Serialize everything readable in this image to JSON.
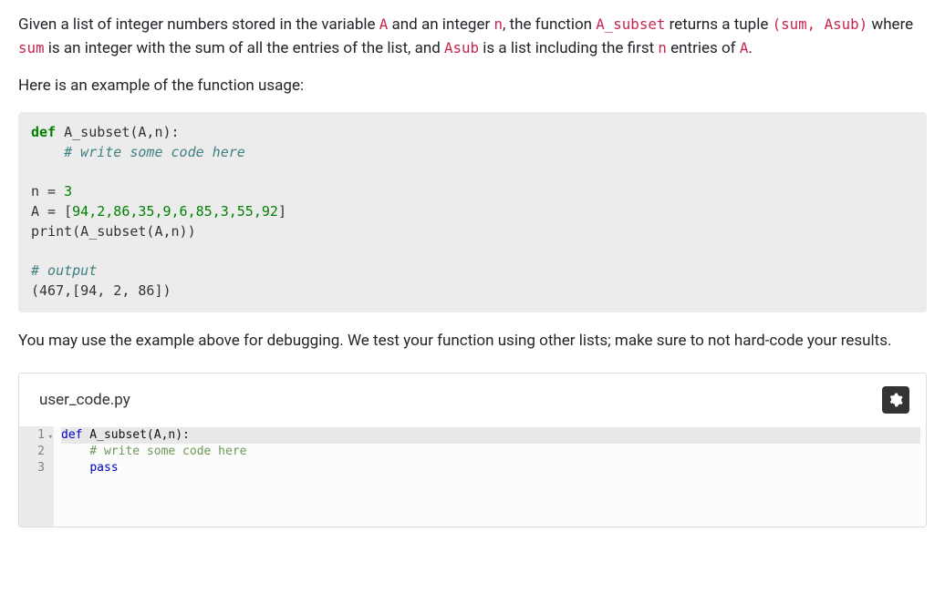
{
  "intro": {
    "t1": "Given a list of integer numbers stored in the variable ",
    "c1": "A",
    "t2": " and an integer ",
    "c2": "n",
    "t3": ", the function ",
    "c3": "A_subset",
    "t4": " returns a tuple ",
    "c4": "(sum, Asub)",
    "t5": " where ",
    "c5": "sum",
    "t6": " is an integer with the sum of all the entries of the list, and ",
    "c6": "Asub",
    "t7": " is a list including the first ",
    "c7": "n",
    "t8": " entries of ",
    "c8": "A",
    "t9": "."
  },
  "example_lead": "Here is an example of the function usage:",
  "code": {
    "kw_def": "def",
    "fn": "A_subset",
    "params": "(A,n):",
    "cmt1": "# write some code here",
    "blank": "",
    "l4": "n = ",
    "n3": "3",
    "l5a": "A = [",
    "nums": "94,2,86,35,9,6,85,3,55,92",
    "l5b": "]",
    "l6": "print(A_subset(A,n))",
    "cmt2": "# output",
    "out": "(467,[94, 2, 86])"
  },
  "followup": "You may use the example above for debugging. We test your function using other lists; make sure to not hard-code your results.",
  "editor": {
    "filename": "user_code.py",
    "gutter": [
      "1",
      "2",
      "3"
    ],
    "line1_kw": "def",
    "line1_rest": " A_subset(A,n):",
    "line2": "    # write some code here",
    "line3_indent": "    ",
    "line3_kw": "pass"
  }
}
